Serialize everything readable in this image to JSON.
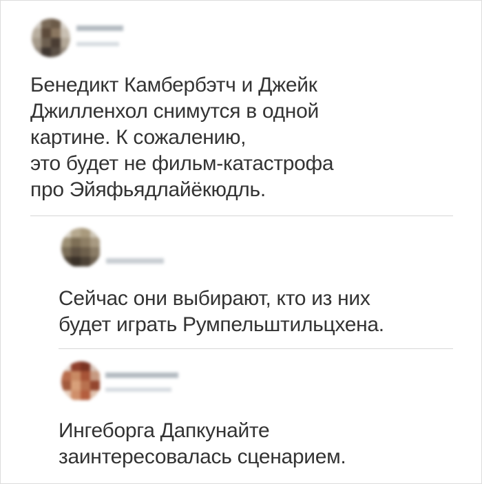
{
  "post": {
    "author_name": "",
    "author_meta": "",
    "lines": [
      "Бенедикт Камбербэтч и Джейк",
      "Джилленхол снимутся в одной",
      "картине. К сожалению,",
      "это будет не фильм-катастрофа",
      "про Эйяфьядлайёкюдль."
    ]
  },
  "replies": [
    {
      "author_name": "",
      "author_meta": "",
      "lines": [
        "Сейчас они выбирают, кто из них",
        "будет играть Румпельштильцхена."
      ]
    },
    {
      "author_name": "",
      "author_meta": "",
      "lines": [
        "Ингеборга Дапкунайте",
        "заинтересовалась сценарием."
      ]
    }
  ],
  "colors": {
    "text": "#333333",
    "divider": "#d6d6d6",
    "border": "#dcdcdc",
    "background": "#ffffff"
  }
}
